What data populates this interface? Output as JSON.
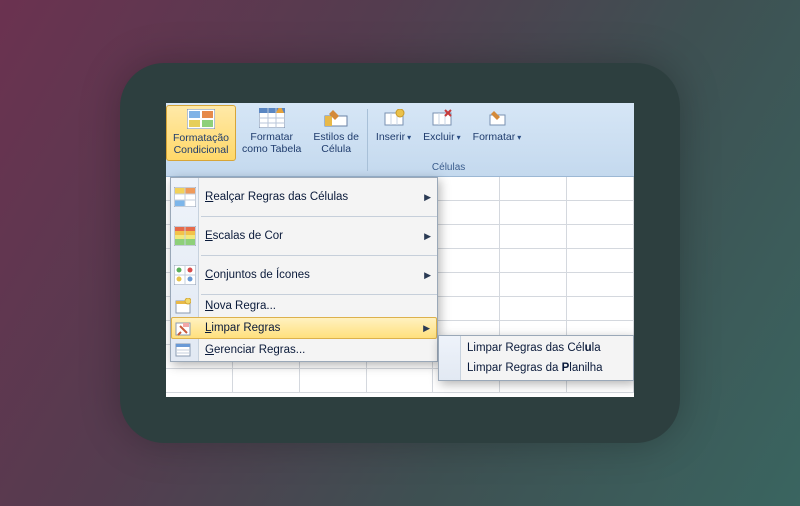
{
  "ribbon": {
    "conditional_formatting": "Formatação\nCondicional",
    "format_as_table": "Formatar\ncomo Tabela",
    "cell_styles": "Estilos de\nCélula",
    "insert": "Inserir",
    "delete": "Excluir",
    "format": "Formatar",
    "cells_group": "Células"
  },
  "menu": {
    "highlight_rules": "Realçar Regras das Células",
    "color_scales": "Escalas de Cor",
    "icon_sets": "Conjuntos de Ícones",
    "new_rule": "Nova Regra...",
    "clear_rules": "Limpar Regras",
    "manage_rules": "Gerenciar Regras..."
  },
  "submenu": {
    "clear_cells": "Limpar Regras das Célula",
    "clear_sheet": "Limpar Regras da Planilha"
  }
}
